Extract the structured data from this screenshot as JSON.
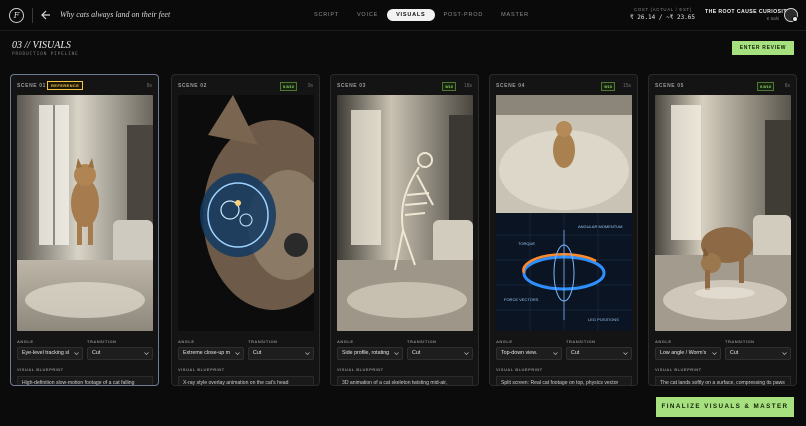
{
  "header": {
    "logo_letter": "F",
    "project_title": "Why cats always land on their feet",
    "steps": [
      {
        "label": "SCRIPT",
        "active": false
      },
      {
        "label": "VOICE",
        "active": false
      },
      {
        "label": "VISUALS",
        "active": true
      },
      {
        "label": "POST-PROD",
        "active": false
      },
      {
        "label": "MASTER",
        "active": false
      }
    ],
    "cost_label": "COST (ACTUAL / EST)",
    "cost_value": "₹ 26.14 / ~₹ 23.65",
    "user_name": "THE ROOT CAUSE CURIOSITY",
    "user_sub": "K Sahi"
  },
  "page": {
    "title": "03 // VISUALS",
    "subtitle": "PRODUCTION PIPELINE",
    "review_button": "ENTER REVIEW",
    "final_button": "FINALIZE VISUALS & MASTER"
  },
  "labels": {
    "angle": "ANGLE",
    "transition": "TRANSITION",
    "blueprint": "VISUAL BLUEPRINT",
    "reference": "REFERENCE"
  },
  "scenes": [
    {
      "label": "SCENE 01",
      "badge": "REFERENCE",
      "score": "",
      "duration": "8s",
      "angle": "Eye-level tracking sl",
      "transition": "Cut",
      "blueprint": "High-definition slow-motion footage of a cat falling"
    },
    {
      "label": "SCENE 02",
      "badge": "",
      "score": "9.5/10",
      "duration": "9s",
      "angle": "Extreme close-up m",
      "transition": "Cut",
      "blueprint": "X-ray style overlay animation on the cat's head"
    },
    {
      "label": "SCENE 03",
      "badge": "",
      "score": "9/10",
      "duration": "18s",
      "angle": "Side profile, rotating",
      "transition": "Cut",
      "blueprint": "3D animation of a cat skeleton twisting mid-air,"
    },
    {
      "label": "SCENE 04",
      "badge": "",
      "score": "9/10",
      "duration": "15s",
      "angle": "Top-down view.",
      "transition": "Cut",
      "blueprint": "Split screen: Real cat footage on top, physics vector"
    },
    {
      "label": "SCENE 05",
      "badge": "",
      "score": "9.5/10",
      "duration": "8s",
      "angle": "Low angle / Worm's",
      "transition": "Cut",
      "blueprint": "The cat lands softly on a surface, compressing its paws"
    }
  ],
  "diagram_labels": {
    "torque": "TORQUE",
    "angular_momentum": "ANGULAR MOMENTUM",
    "force_vectors": "FORCE VECTORS",
    "leg_positions": "LEG POSITIONS"
  },
  "colors": {
    "accent_green": "#a7e07e",
    "reference_yellow": "#f3c64a",
    "score_green": "#8ccf6a"
  }
}
